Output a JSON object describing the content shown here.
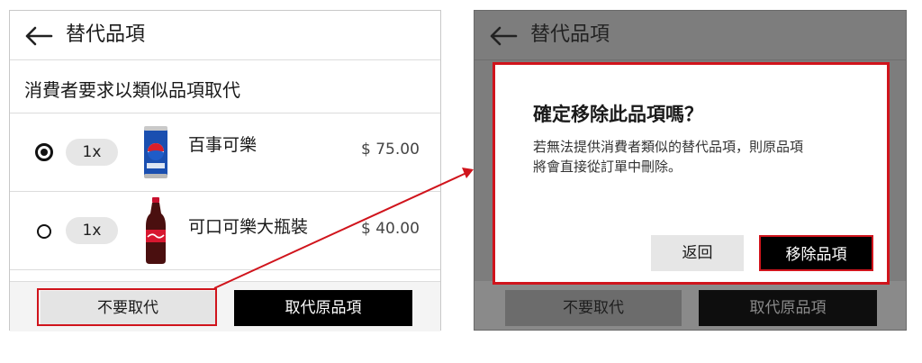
{
  "left": {
    "header": {
      "title": "替代品項",
      "back_icon": "arrow-left-icon"
    },
    "section_title": "消費者要求以類似品項取代",
    "items": [
      {
        "selected": true,
        "quantity": "1x",
        "name": "百事可樂",
        "price": "$ 75.00",
        "image": "pepsi-can-image"
      },
      {
        "selected": false,
        "quantity": "1x",
        "name": "可口可樂大瓶裝",
        "price": "$ 40.00",
        "image": "coca-cola-bottle-image"
      }
    ],
    "buttons": {
      "no_substitute": "不要取代",
      "replace_item": "取代原品項"
    }
  },
  "right": {
    "header": {
      "title": "替代品項",
      "back_icon": "arrow-left-icon"
    },
    "dialog": {
      "title": "確定移除此品項嗎？",
      "message_line1": "若無法提供消費者類似的替代品項，則原品項",
      "message_line2": "將會直接從訂單中刪除。",
      "back_label": "返回",
      "remove_label": "移除品項"
    },
    "buttons": {
      "no_substitute": "不要取代",
      "replace_item": "取代原品項"
    }
  },
  "colors": {
    "highlight": "#d0141c",
    "dark_button": "#000000",
    "overlay": "#7d7d7d"
  }
}
